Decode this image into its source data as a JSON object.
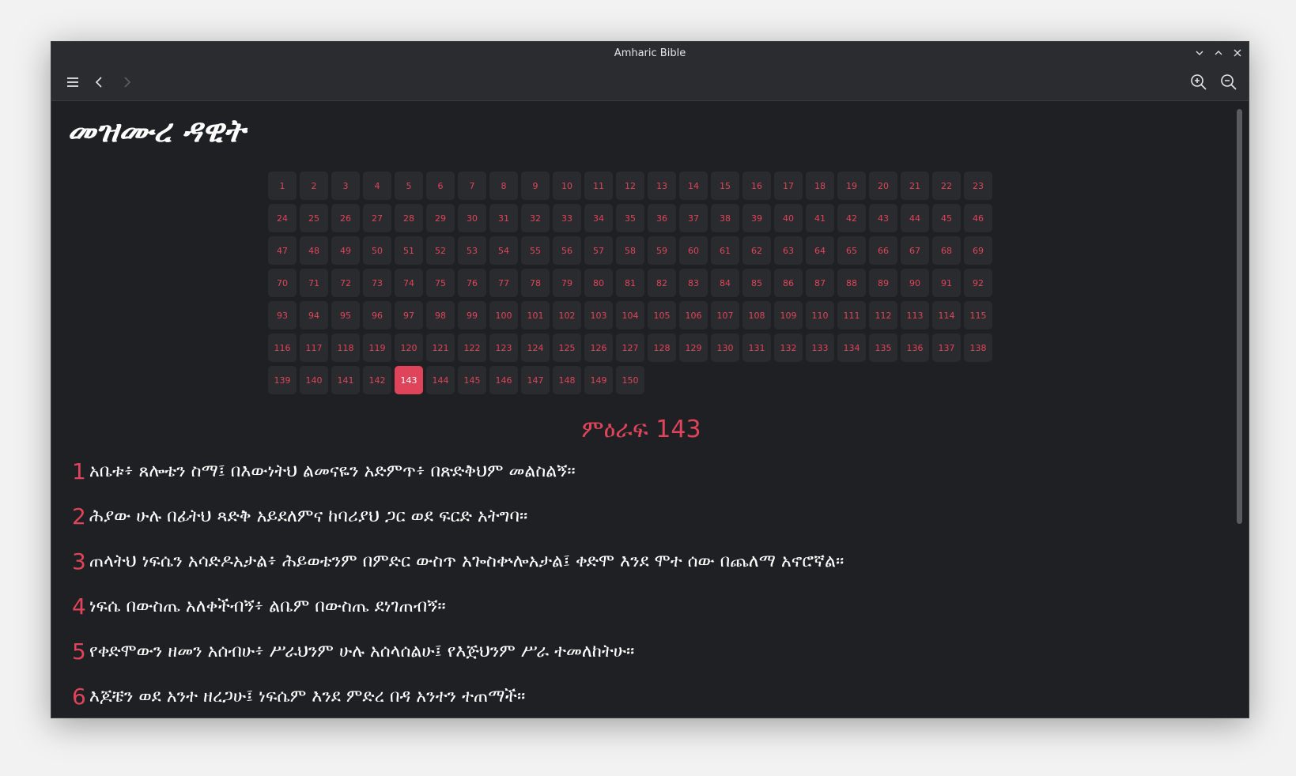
{
  "window": {
    "title": "Amharic Bible"
  },
  "book": {
    "title": "መዝሙረ ዳዊት"
  },
  "chapters": {
    "total": 150,
    "selected": 143
  },
  "chapter_heading": "ምዕራፍ 143",
  "verses": [
    {
      "num": "1",
      "text": "አቤቱ፥ ጸሎቴን ስማ፤ በእውነትህ ልመናዬን አድምጥ፥ በጽድቅህም መልስልኝ።"
    },
    {
      "num": "2",
      "text": "ሕያው ሁሉ በፊትህ ጻድቅ አይደለምና ከባሪያህ ጋር ወደ ፍርድ አትግባ።"
    },
    {
      "num": "3",
      "text": "ጠላትህ ነፍሴን አሳድዶአታል፥ ሕይወቴንም በምድር ውስጥ አጐስቍሎአታል፤ ቀድሞ እንደ ሞተ ሰው በጨለማ አኖሮኛል።"
    },
    {
      "num": "4",
      "text": "ነፍሴ በውስጤ አለቀችብኝ፥ ልቤም በውስጤ ደነገጠብኝ።"
    },
    {
      "num": "5",
      "text": "የቀድሞውን ዘመን አሰብሁ፥ ሥራህንም ሁሉ አሰላሰልሁ፤ የእጅህንም ሥራ ተመለከትሁ።"
    },
    {
      "num": "6",
      "text": "እጆቼን ወደ አንተ ዘረጋሁ፤ ነፍሴም እንደ ምድረ በዳ አንተን ተጠማች።"
    }
  ],
  "icons": {
    "menu": "hamburger-menu-icon",
    "back": "chevron-left-icon",
    "forward": "chevron-right-icon",
    "zoom_in": "zoom-in-icon",
    "zoom_out": "zoom-out-icon",
    "minimize": "chevron-down-icon",
    "maximize": "chevron-up-icon",
    "close": "close-icon"
  },
  "colors": {
    "accent": "#e0445a",
    "background": "#1f2023",
    "toolbar": "#2b2c2f",
    "chapter_button": "#2a2b2e",
    "text": "#ffffff"
  }
}
